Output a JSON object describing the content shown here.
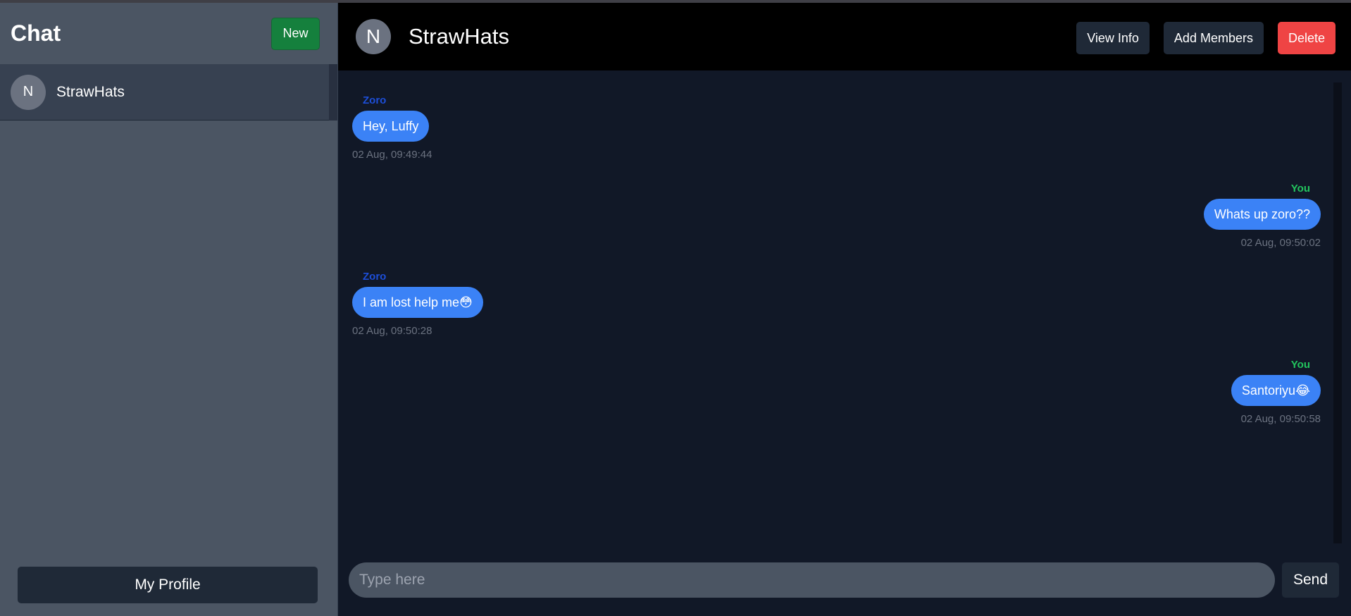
{
  "sidebar": {
    "title": "Chat",
    "new_label": "New",
    "chats": [
      {
        "avatar": "N",
        "name": "StrawHats"
      }
    ],
    "profile_label": "My Profile"
  },
  "header": {
    "avatar": "N",
    "group_name": "StrawHats",
    "view_info_label": "View Info",
    "add_members_label": "Add Members",
    "delete_label": "Delete"
  },
  "messages": [
    {
      "sender": "Zoro",
      "text": "Hey, Luffy",
      "time": "02 Aug, 09:49:44",
      "side": "left"
    },
    {
      "sender": "You",
      "text": "Whats up zoro??",
      "time": "02 Aug, 09:50:02",
      "side": "right"
    },
    {
      "sender": "Zoro",
      "text": "I am lost help me😳",
      "time": "02 Aug, 09:50:28",
      "side": "left"
    },
    {
      "sender": "You",
      "text": "Santoriyu😂",
      "time": "02 Aug, 09:50:58",
      "side": "right"
    }
  ],
  "composer": {
    "placeholder": "Type here",
    "send_label": "Send"
  },
  "colors": {
    "sidebar_bg": "#4b5563",
    "header_bg": "#000000",
    "chat_bg": "#111827",
    "bubble": "#3b82f6",
    "new_button": "#15803d",
    "delete_button": "#ef4444",
    "other_sender": "#1d4ed8",
    "own_sender": "#22c55e"
  }
}
